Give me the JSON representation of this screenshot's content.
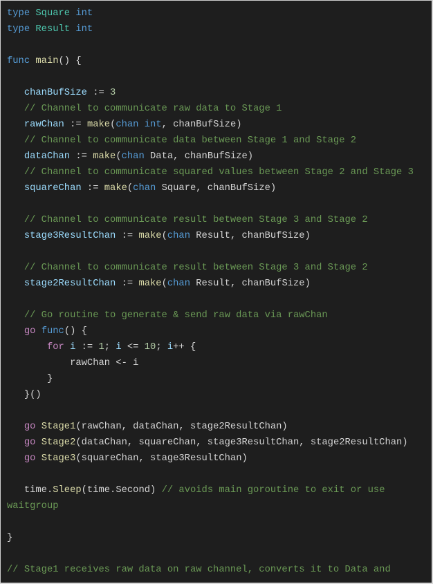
{
  "language": "go",
  "colors": {
    "background": "#1e1e1e",
    "keyword": "#569cd6",
    "type": "#4ec9b0",
    "control": "#c586c0",
    "function": "#dcdcaa",
    "variable": "#9cdcfe",
    "number": "#b5cea8",
    "comment": "#6a9955",
    "plain": "#d4d4d4"
  },
  "lines": [
    [
      [
        "kw",
        "type"
      ],
      [
        "plain",
        " "
      ],
      [
        "type",
        "Square"
      ],
      [
        "plain",
        " "
      ],
      [
        "kw",
        "int"
      ]
    ],
    [
      [
        "kw",
        "type"
      ],
      [
        "plain",
        " "
      ],
      [
        "type",
        "Result"
      ],
      [
        "plain",
        " "
      ],
      [
        "kw",
        "int"
      ]
    ],
    [],
    [
      [
        "kw",
        "func"
      ],
      [
        "plain",
        " "
      ],
      [
        "fn",
        "main"
      ],
      [
        "plain",
        "() {"
      ]
    ],
    [],
    [
      [
        "plain",
        "   "
      ],
      [
        "var",
        "chanBufSize"
      ],
      [
        "plain",
        " := "
      ],
      [
        "num",
        "3"
      ]
    ],
    [
      [
        "plain",
        "   "
      ],
      [
        "com",
        "// Channel to communicate raw data to Stage 1"
      ]
    ],
    [
      [
        "plain",
        "   "
      ],
      [
        "var",
        "rawChan"
      ],
      [
        "plain",
        " := "
      ],
      [
        "fn",
        "make"
      ],
      [
        "plain",
        "("
      ],
      [
        "kw",
        "chan"
      ],
      [
        "plain",
        " "
      ],
      [
        "kw",
        "int"
      ],
      [
        "plain",
        ", chanBufSize)"
      ]
    ],
    [
      [
        "plain",
        "   "
      ],
      [
        "com",
        "// Channel to communicate data between Stage 1 and Stage 2"
      ]
    ],
    [
      [
        "plain",
        "   "
      ],
      [
        "var",
        "dataChan"
      ],
      [
        "plain",
        " := "
      ],
      [
        "fn",
        "make"
      ],
      [
        "plain",
        "("
      ],
      [
        "kw",
        "chan"
      ],
      [
        "plain",
        " Data, chanBufSize)"
      ]
    ],
    [
      [
        "plain",
        "   "
      ],
      [
        "com",
        "// Channel to communicate squared values between Stage 2 and Stage 3"
      ]
    ],
    [
      [
        "plain",
        "   "
      ],
      [
        "var",
        "squareChan"
      ],
      [
        "plain",
        " := "
      ],
      [
        "fn",
        "make"
      ],
      [
        "plain",
        "("
      ],
      [
        "kw",
        "chan"
      ],
      [
        "plain",
        " Square, chanBufSize)"
      ]
    ],
    [],
    [
      [
        "plain",
        "   "
      ],
      [
        "com",
        "// Channel to communicate result between Stage 3 and Stage 2"
      ]
    ],
    [
      [
        "plain",
        "   "
      ],
      [
        "var",
        "stage3ResultChan"
      ],
      [
        "plain",
        " := "
      ],
      [
        "fn",
        "make"
      ],
      [
        "plain",
        "("
      ],
      [
        "kw",
        "chan"
      ],
      [
        "plain",
        " Result, chanBufSize)"
      ]
    ],
    [],
    [
      [
        "plain",
        "   "
      ],
      [
        "com",
        "// Channel to communicate result between Stage 3 and Stage 2"
      ]
    ],
    [
      [
        "plain",
        "   "
      ],
      [
        "var",
        "stage2ResultChan"
      ],
      [
        "plain",
        " := "
      ],
      [
        "fn",
        "make"
      ],
      [
        "plain",
        "("
      ],
      [
        "kw",
        "chan"
      ],
      [
        "plain",
        " Result, chanBufSize)"
      ]
    ],
    [],
    [
      [
        "plain",
        "   "
      ],
      [
        "com",
        "// Go routine to generate & send raw data via rawChan"
      ]
    ],
    [
      [
        "plain",
        "   "
      ],
      [
        "ctrl",
        "go"
      ],
      [
        "plain",
        " "
      ],
      [
        "kw",
        "func"
      ],
      [
        "plain",
        "() {"
      ]
    ],
    [
      [
        "plain",
        "       "
      ],
      [
        "ctrl",
        "for"
      ],
      [
        "plain",
        " "
      ],
      [
        "var",
        "i"
      ],
      [
        "plain",
        " := "
      ],
      [
        "num",
        "1"
      ],
      [
        "plain",
        "; "
      ],
      [
        "var",
        "i"
      ],
      [
        "plain",
        " <= "
      ],
      [
        "num",
        "10"
      ],
      [
        "plain",
        "; "
      ],
      [
        "var",
        "i"
      ],
      [
        "plain",
        "++ {"
      ]
    ],
    [
      [
        "plain",
        "           rawChan <- i"
      ]
    ],
    [
      [
        "plain",
        "       }"
      ]
    ],
    [
      [
        "plain",
        "   }()"
      ]
    ],
    [],
    [
      [
        "plain",
        "   "
      ],
      [
        "ctrl",
        "go"
      ],
      [
        "plain",
        " "
      ],
      [
        "fn",
        "Stage1"
      ],
      [
        "plain",
        "(rawChan, dataChan, stage2ResultChan)"
      ]
    ],
    [
      [
        "plain",
        "   "
      ],
      [
        "ctrl",
        "go"
      ],
      [
        "plain",
        " "
      ],
      [
        "fn",
        "Stage2"
      ],
      [
        "plain",
        "(dataChan, squareChan, stage3ResultChan, stage2ResultChan)"
      ]
    ],
    [
      [
        "plain",
        "   "
      ],
      [
        "ctrl",
        "go"
      ],
      [
        "plain",
        " "
      ],
      [
        "fn",
        "Stage3"
      ],
      [
        "plain",
        "(squareChan, stage3ResultChan)"
      ]
    ],
    [],
    [
      [
        "plain",
        "   time."
      ],
      [
        "fn",
        "Sleep"
      ],
      [
        "plain",
        "(time.Second) "
      ],
      [
        "com",
        "// avoids main goroutine to exit or use"
      ]
    ],
    [
      [
        "com",
        "waitgroup"
      ]
    ],
    [],
    [
      [
        "plain",
        "}"
      ]
    ],
    [],
    [
      [
        "com",
        "// Stage1 receives raw data on raw channel, converts it to Data and"
      ]
    ]
  ]
}
